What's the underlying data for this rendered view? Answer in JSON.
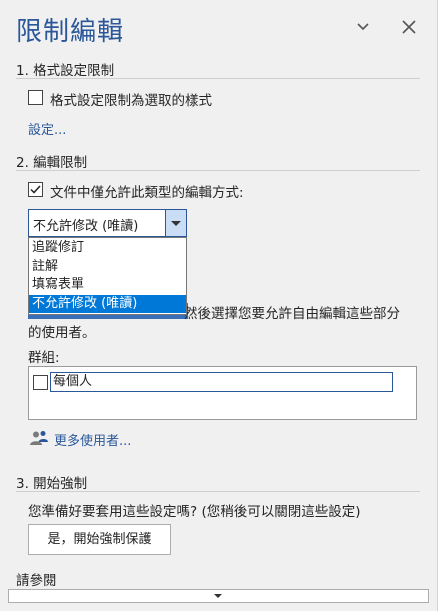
{
  "pane": {
    "title": "限制編輯"
  },
  "section1": {
    "heading": "1. 格式設定限制",
    "checkbox_label": "格式設定限制為選取的樣式",
    "checked": false,
    "settings_link": "設定..."
  },
  "section2": {
    "heading": "2. 編輯限制",
    "checkbox_label": "文件中僅允許此類型的編輯方式:",
    "checked": true,
    "select": {
      "value": "不允許修改 (唯讀)",
      "options": [
        "追蹤修訂",
        "註解",
        "填寫表單",
        "不允許修改 (唯讀)"
      ],
      "selected_index": 3
    },
    "exceptions_line1": "然後選擇您要允許自由編輯這些部分",
    "exceptions_line2": "的使用者。",
    "groups_label": "群組:",
    "groups": [
      {
        "name": "每個人",
        "checked": false
      }
    ],
    "more_users_link": "更多使用者..."
  },
  "section3": {
    "heading": "3. 開始強制",
    "prompt": "您準備好要套用這些設定嗎? (您稍後可以關閉這些設定)",
    "button_label": "是，開始強制保護"
  },
  "see_also": {
    "heading": "請參閱"
  },
  "colors": {
    "accent": "#2b579a",
    "highlight": "#0078d7"
  },
  "icons": [
    "chevron-down-icon",
    "close-icon",
    "checkmark-icon",
    "users-icon"
  ]
}
